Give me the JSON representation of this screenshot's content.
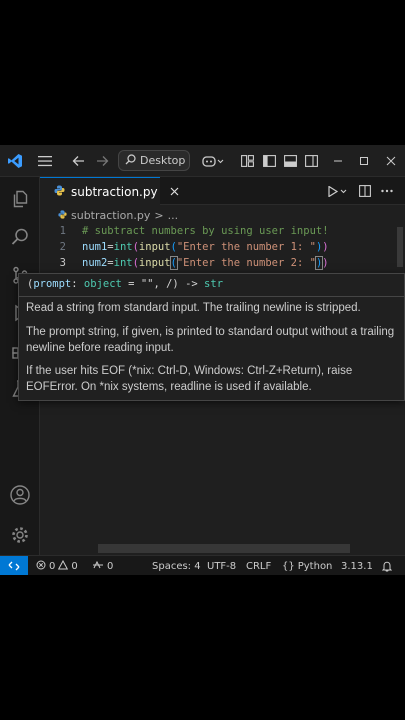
{
  "titlebar": {
    "search_label": "Desktop"
  },
  "tab": {
    "filename": "subtraction.py"
  },
  "breadcrumb": {
    "file": "subtraction.py",
    "separator": ">",
    "more": "..."
  },
  "editor": {
    "lines": [
      {
        "number": "1",
        "comment": "# subtract numbers by using user input!"
      },
      {
        "number": "2",
        "var": "num1",
        "eq": "=",
        "fn_int": "int",
        "p1": "(",
        "fn_input": "input",
        "p2": "(",
        "str": "\"Enter the number 1: \"",
        "p3": ")",
        "p4": ")"
      },
      {
        "number": "3",
        "var": "num2",
        "eq": "=",
        "fn_int": "int",
        "p1": "(",
        "fn_input": "input",
        "p2": "(",
        "str": "\"Enter the number 2: \"",
        "p3": ")",
        "p4": ")"
      }
    ]
  },
  "hover": {
    "sig_open": "(",
    "sig_param": "prompt",
    "sig_colon": ": ",
    "sig_type": "object",
    "sig_default": " = \"\", /) -> ",
    "sig_return": "str",
    "p1": "Read a string from standard input. The trailing newline is stripped.",
    "p2": "The prompt string, if given, is printed to standard output without a trailing newline before reading input.",
    "p3": "If the user hits EOF (*nix: Ctrl-D, Windows: Ctrl-Z+Return), raise EOFError. On *nix systems, readline is used if available."
  },
  "statusbar": {
    "errors": "0",
    "warnings": "0",
    "ports": "0",
    "spaces": "Spaces: 4",
    "encoding": "UTF-8",
    "eol": "CRLF",
    "language_icon": "{}",
    "language": "Python",
    "version": "3.13.1"
  },
  "colors": {
    "accent": "#0078d4",
    "background": "#1f1f1f",
    "comment": "#6a9955",
    "string": "#ce9178",
    "function": "#dcdcaa"
  },
  "icons": [
    "vscode-logo-icon",
    "menu-icon",
    "back-arrow-icon",
    "forward-arrow-icon",
    "search-icon",
    "copilot-icon",
    "layout-icon",
    "minimize-icon",
    "maximize-icon",
    "close-icon",
    "explorer-icon",
    "search-sidebar-icon",
    "source-control-icon",
    "run-debug-icon",
    "extensions-icon",
    "testing-icon",
    "account-icon",
    "settings-gear-icon",
    "run-icon",
    "split-editor-icon",
    "more-actions-icon",
    "python-file-icon",
    "remote-icon",
    "bell-icon"
  ]
}
